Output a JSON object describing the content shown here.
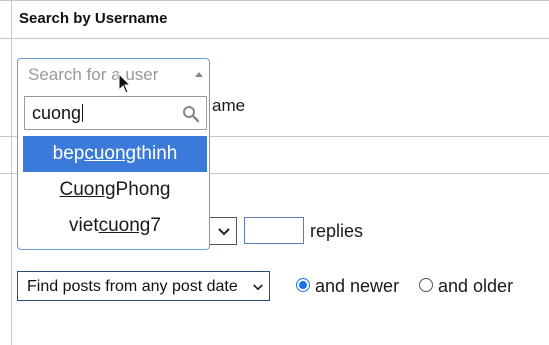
{
  "section": {
    "title": "Search by Username"
  },
  "background_text": {
    "username_suffix": "ame"
  },
  "user_combo": {
    "placeholder": "Search for a user",
    "search_value": "cuong",
    "results": [
      {
        "prefix": "bep",
        "match": "cuong",
        "suffix": "thinh",
        "highlighted": true
      },
      {
        "prefix": "",
        "match": "Cuong",
        "suffix": "Phong",
        "highlighted": false
      },
      {
        "prefix": "viet",
        "match": "cuong",
        "suffix": "7",
        "highlighted": false
      }
    ]
  },
  "replies": {
    "value": "",
    "label": "replies"
  },
  "post_date": {
    "selected": "Find posts from any post date",
    "newer_label": "and newer",
    "older_label": "and older",
    "newer_selected": true
  },
  "colors": {
    "highlight": "#3b7ad9",
    "focus_border": "#6a9bd8",
    "radio": "#1a73e8"
  }
}
